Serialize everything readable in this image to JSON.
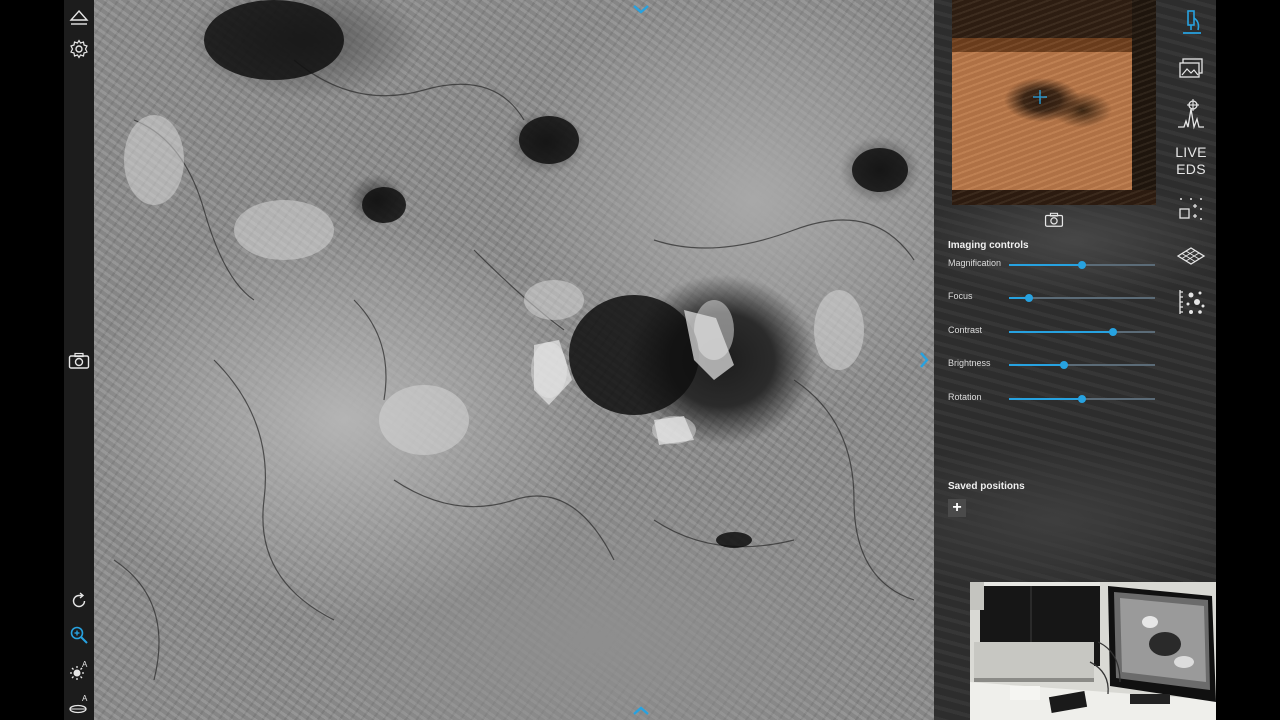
{
  "left_toolbar": {
    "icons": [
      "eject-icon",
      "gear-icon",
      "camera-icon",
      "rotate-icon",
      "zoom-icon",
      "auto-contrast-icon",
      "auto-focus-icon"
    ],
    "auto_contrast_badge": "A",
    "auto_focus_badge": "A"
  },
  "sem_view": {
    "nav_up": "chevron-up-icon",
    "nav_right": "chevron-right-icon",
    "nav_down": "chevron-down-icon"
  },
  "right_toolbar": {
    "live_eds_line1": "LIVE",
    "live_eds_line2": "EDS",
    "icons": [
      "microscope-icon",
      "gallery-icon",
      "spectrum-icon",
      "multi-tile-icon",
      "3d-surface-icon",
      "particle-analysis-icon"
    ]
  },
  "imaging_controls": {
    "title": "Imaging controls",
    "sliders": [
      {
        "label": "Magnification",
        "value": 0.5
      },
      {
        "label": "Focus",
        "value": 0.14
      },
      {
        "label": "Contrast",
        "value": 0.71
      },
      {
        "label": "Brightness",
        "value": 0.38
      },
      {
        "label": "Rotation",
        "value": 0.5
      }
    ]
  },
  "saved_positions": {
    "title": "Saved positions",
    "add_label": "+"
  },
  "colors": {
    "accent": "#27a2e0",
    "panel_bg": "#2f2f2f",
    "toolbar_bg": "#1c1c1c"
  }
}
